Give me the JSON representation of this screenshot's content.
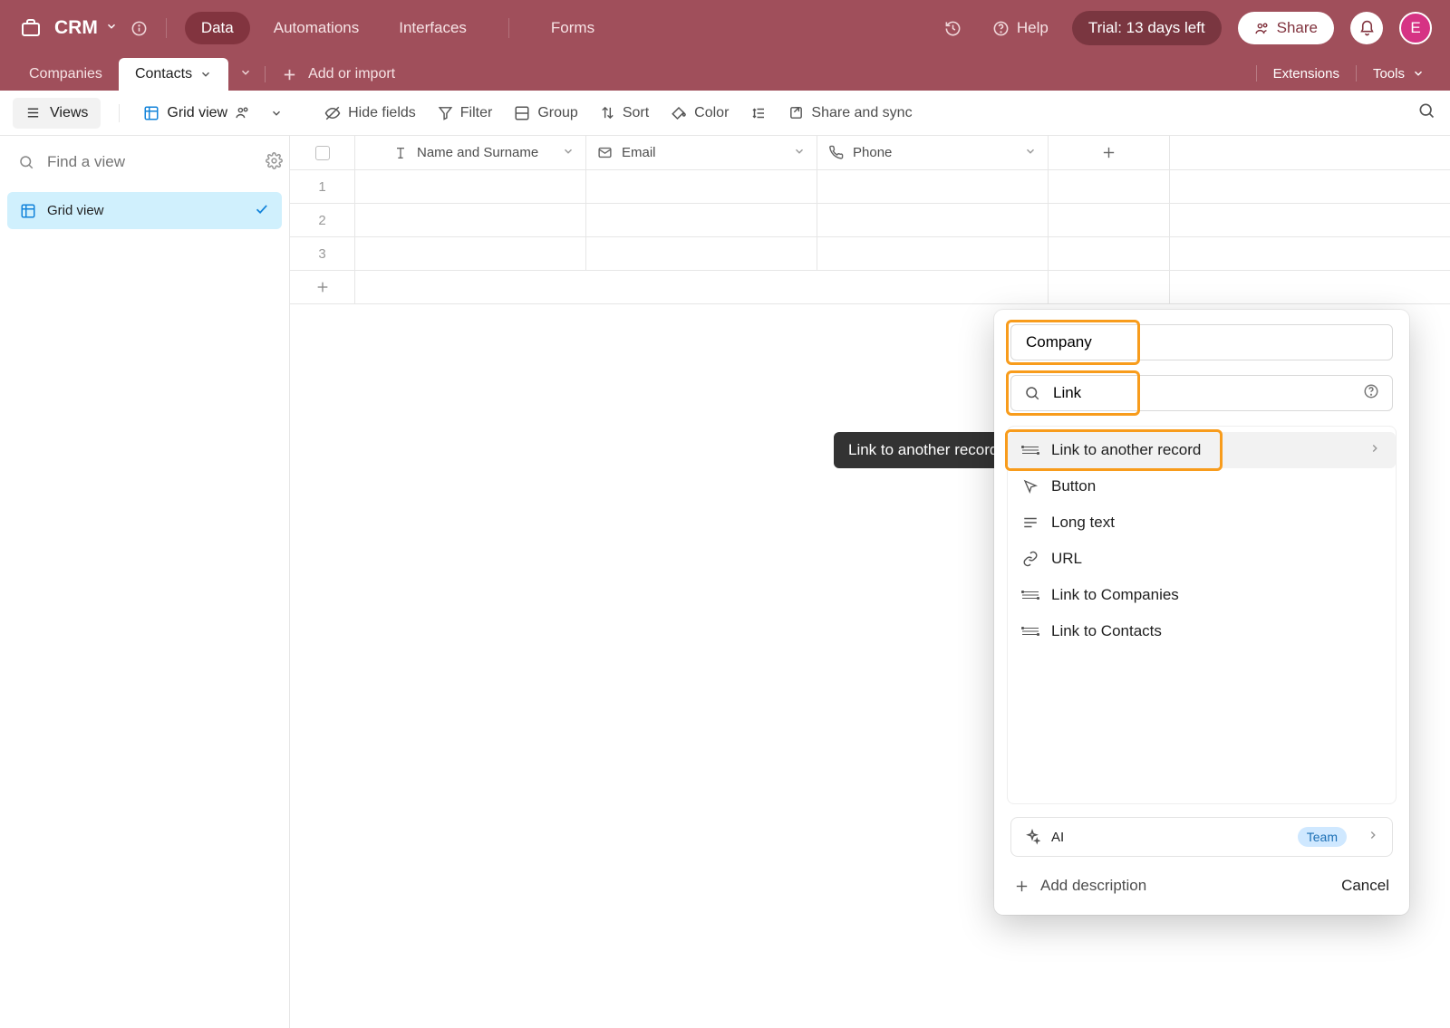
{
  "header": {
    "app_name": "CRM",
    "nav": {
      "data": "Data",
      "automations": "Automations",
      "interfaces": "Interfaces",
      "forms": "Forms"
    },
    "help": "Help",
    "trial": "Trial: 13 days left",
    "share": "Share",
    "avatar_initial": "E"
  },
  "table_bar": {
    "companies": "Companies",
    "contacts": "Contacts",
    "add_or_import": "Add or import",
    "extensions": "Extensions",
    "tools": "Tools"
  },
  "toolbar": {
    "views": "Views",
    "grid_view": "Grid view",
    "hide_fields": "Hide fields",
    "filter": "Filter",
    "group": "Group",
    "sort": "Sort",
    "color": "Color",
    "share_sync": "Share and sync"
  },
  "sidebar": {
    "find_placeholder": "Find a view",
    "view_label": "Grid view"
  },
  "grid": {
    "columns": {
      "name": "Name and Surname",
      "email": "Email",
      "phone": "Phone"
    },
    "rows": [
      "1",
      "2",
      "3"
    ]
  },
  "tooltip": "Link to another record",
  "popover": {
    "field_name": "Company",
    "search_value": "Link",
    "items": [
      {
        "label": "Link to another record",
        "icon": "link-record",
        "selected": true,
        "chevron": true
      },
      {
        "label": "Button",
        "icon": "cursor"
      },
      {
        "label": "Long text",
        "icon": "long-text"
      },
      {
        "label": "URL",
        "icon": "url"
      },
      {
        "label": "Link to Companies",
        "icon": "link-record"
      },
      {
        "label": "Link to Contacts",
        "icon": "link-record"
      }
    ],
    "ai": "AI",
    "team_badge": "Team",
    "add_description": "Add description",
    "cancel": "Cancel"
  }
}
